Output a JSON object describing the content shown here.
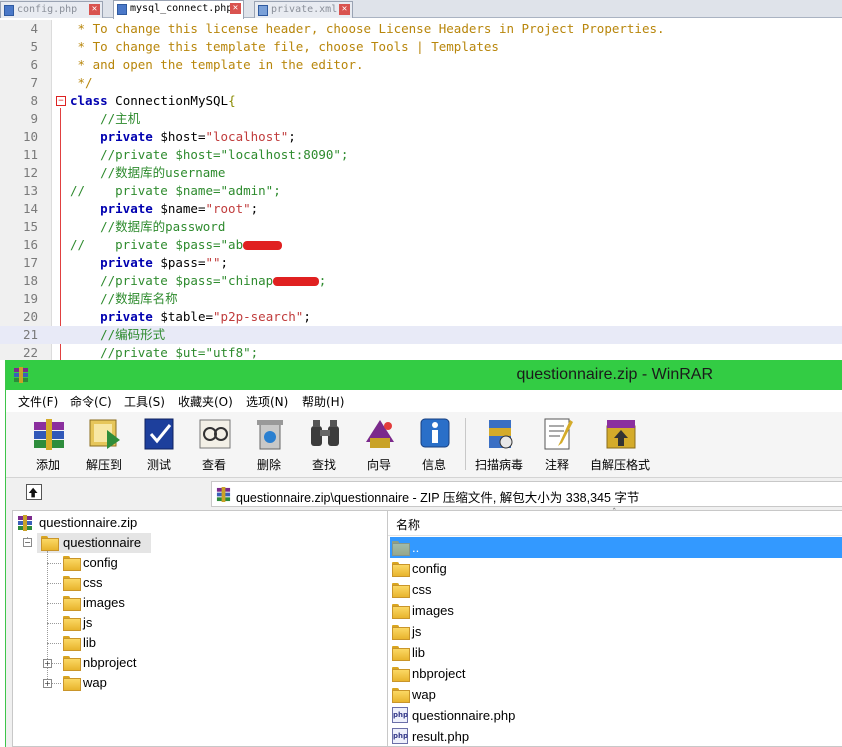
{
  "editor": {
    "tabs": [
      {
        "label": "config.php",
        "active": false
      },
      {
        "label": "mysql_connect.php",
        "active": true
      },
      {
        "label": "private.xml",
        "active": false
      }
    ],
    "lines": [
      {
        "num": "4",
        "parts": [
          {
            "cls": "cmt",
            "t": " * To change this license header, choose License Headers in Project Properties."
          }
        ]
      },
      {
        "num": "5",
        "parts": [
          {
            "cls": "cmt",
            "t": " * To change this template file, choose Tools | Templates"
          }
        ]
      },
      {
        "num": "6",
        "parts": [
          {
            "cls": "cmt",
            "t": " * and open the template in the editor."
          }
        ]
      },
      {
        "num": "7",
        "parts": [
          {
            "cls": "cmt",
            "t": " */"
          }
        ]
      },
      {
        "num": "8",
        "parts": [
          {
            "cls": "kw",
            "t": "class"
          },
          {
            "cls": "plain",
            "t": " ConnectionMySQL"
          },
          {
            "cls": "cmt2",
            "t": "{"
          }
        ]
      },
      {
        "num": "9",
        "parts": [
          {
            "cls": "lc",
            "t": "    //主机"
          }
        ]
      },
      {
        "num": "10",
        "parts": [
          {
            "cls": "kw",
            "t": "    private"
          },
          {
            "cls": "plain",
            "t": " $host="
          },
          {
            "cls": "str",
            "t": "\"localhost\""
          },
          {
            "cls": "plain",
            "t": ";"
          }
        ]
      },
      {
        "num": "11",
        "parts": [
          {
            "cls": "lc",
            "t": "    //private $host=\"localhost:8090\";"
          }
        ]
      },
      {
        "num": "12",
        "parts": [
          {
            "cls": "lc",
            "t": "    //数据库的username"
          }
        ]
      },
      {
        "num": "13",
        "parts": [
          {
            "cls": "lc",
            "t": "//    private $name=\"admin\";"
          }
        ]
      },
      {
        "num": "14",
        "parts": [
          {
            "cls": "kw",
            "t": "    private"
          },
          {
            "cls": "plain",
            "t": " $name="
          },
          {
            "cls": "str",
            "t": "\"root\""
          },
          {
            "cls": "plain",
            "t": ";"
          }
        ]
      },
      {
        "num": "15",
        "parts": [
          {
            "cls": "lc",
            "t": "    //数据库的password"
          }
        ]
      },
      {
        "num": "16",
        "parts": [
          {
            "cls": "lc",
            "t": "//    private $pass=\"ab"
          },
          {
            "cls": "redact",
            "t": "      "
          },
          {
            "cls": "lc",
            "t": ""
          }
        ]
      },
      {
        "num": "17",
        "parts": [
          {
            "cls": "kw",
            "t": "    private"
          },
          {
            "cls": "plain",
            "t": " $pass="
          },
          {
            "cls": "str",
            "t": "\"\""
          },
          {
            "cls": "plain",
            "t": ";"
          }
        ]
      },
      {
        "num": "18",
        "parts": [
          {
            "cls": "lc",
            "t": "    //private $pass=\"chinap"
          },
          {
            "cls": "redact",
            "t": "       "
          },
          {
            "cls": "lc",
            "t": ";"
          }
        ]
      },
      {
        "num": "19",
        "parts": [
          {
            "cls": "lc",
            "t": "    //数据库名称"
          }
        ]
      },
      {
        "num": "20",
        "parts": [
          {
            "cls": "kw",
            "t": "    private"
          },
          {
            "cls": "plain",
            "t": " $table="
          },
          {
            "cls": "str",
            "t": "\"p2p-search\""
          },
          {
            "cls": "plain",
            "t": ";"
          }
        ]
      },
      {
        "num": "21",
        "parts": [
          {
            "cls": "lc",
            "t": "    //编码形式"
          }
        ],
        "highlight": true
      },
      {
        "num": "22",
        "parts": [
          {
            "cls": "lc",
            "t": "    //private $ut=\"utf8\";"
          }
        ]
      }
    ]
  },
  "winrar": {
    "title": "questionnaire.zip - WinRAR",
    "menu": [
      "文件(F)",
      "命令(C)",
      "工具(S)",
      "收藏夹(O)",
      "选项(N)",
      "帮助(H)"
    ],
    "toolbar": [
      {
        "label": "添加",
        "icon": "add-archive-icon"
      },
      {
        "label": "解压到",
        "icon": "extract-to-icon"
      },
      {
        "label": "测试",
        "icon": "test-icon"
      },
      {
        "label": "查看",
        "icon": "view-icon"
      },
      {
        "label": "删除",
        "icon": "delete-icon"
      },
      {
        "label": "查找",
        "icon": "find-icon"
      },
      {
        "label": "向导",
        "icon": "wizard-icon"
      },
      {
        "label": "信息",
        "icon": "info-icon"
      },
      {
        "label": "扫描病毒",
        "icon": "virus-scan-icon"
      },
      {
        "label": "注释",
        "icon": "comment-icon"
      },
      {
        "label": "自解压格式",
        "icon": "sfx-icon"
      }
    ],
    "address": "questionnaire.zip\\questionnaire - ZIP 压缩文件, 解包大小为 338,345 字节",
    "tree": {
      "root": "questionnaire.zip",
      "folder": "questionnaire",
      "children": [
        "config",
        "css",
        "images",
        "js",
        "lib",
        "nbproject",
        "wap"
      ]
    },
    "filelist": {
      "column_name": "名称",
      "rows": [
        {
          "name": "..",
          "type": "up"
        },
        {
          "name": "config",
          "type": "folder"
        },
        {
          "name": "css",
          "type": "folder"
        },
        {
          "name": "images",
          "type": "folder"
        },
        {
          "name": "js",
          "type": "folder"
        },
        {
          "name": "lib",
          "type": "folder"
        },
        {
          "name": "nbproject",
          "type": "folder"
        },
        {
          "name": "wap",
          "type": "folder"
        },
        {
          "name": "questionnaire.php",
          "type": "php"
        },
        {
          "name": "result.php",
          "type": "php"
        }
      ]
    },
    "colors": {
      "titlebar": "#33cc44",
      "selection": "#3399ff"
    }
  }
}
